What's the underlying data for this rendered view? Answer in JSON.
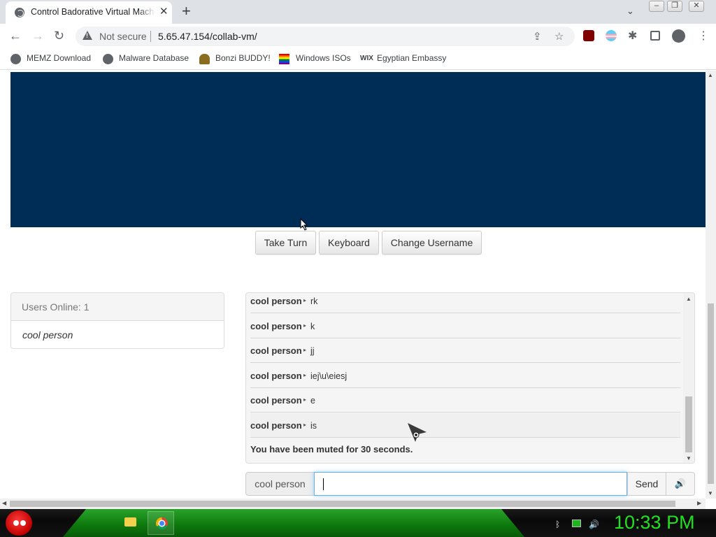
{
  "browser": {
    "tab_title": "Control Badorative Virtual Machine",
    "new_tab": "+",
    "close": "✕",
    "security_label": "Not secure",
    "url": "5.65.47.154/collab-vm/",
    "bookmarks": [
      {
        "label": "MEMZ Download"
      },
      {
        "label": "Malware Database"
      },
      {
        "label": "Bonzi BUDDY!"
      },
      {
        "label": "Windows ISOs"
      },
      {
        "label": "Egyptian Embassy"
      }
    ]
  },
  "controls": {
    "take_turn": "Take Turn",
    "keyboard": "Keyboard",
    "change_username": "Change Username"
  },
  "users": {
    "header": "Users Online: 1",
    "list": [
      "cool person"
    ]
  },
  "chat": {
    "messages": [
      {
        "user": "cool person",
        "text": "rk"
      },
      {
        "user": "cool person",
        "text": "k"
      },
      {
        "user": "cool person",
        "text": "jj"
      },
      {
        "user": "cool person",
        "text": "iej\\u\\eiesj"
      },
      {
        "user": "cool person",
        "text": "e"
      },
      {
        "user": "cool person",
        "text": "is"
      }
    ],
    "system_message": "You have been muted for 30 seconds.",
    "username": "cool person",
    "input_value": "",
    "send_label": "Send",
    "audio_icon": "🔊"
  },
  "taskbar": {
    "clock": "10:33 PM"
  },
  "colors": {
    "vm_screen": "#002d55",
    "clock": "#20e020",
    "taskbar_green": "#0d7a0d"
  }
}
